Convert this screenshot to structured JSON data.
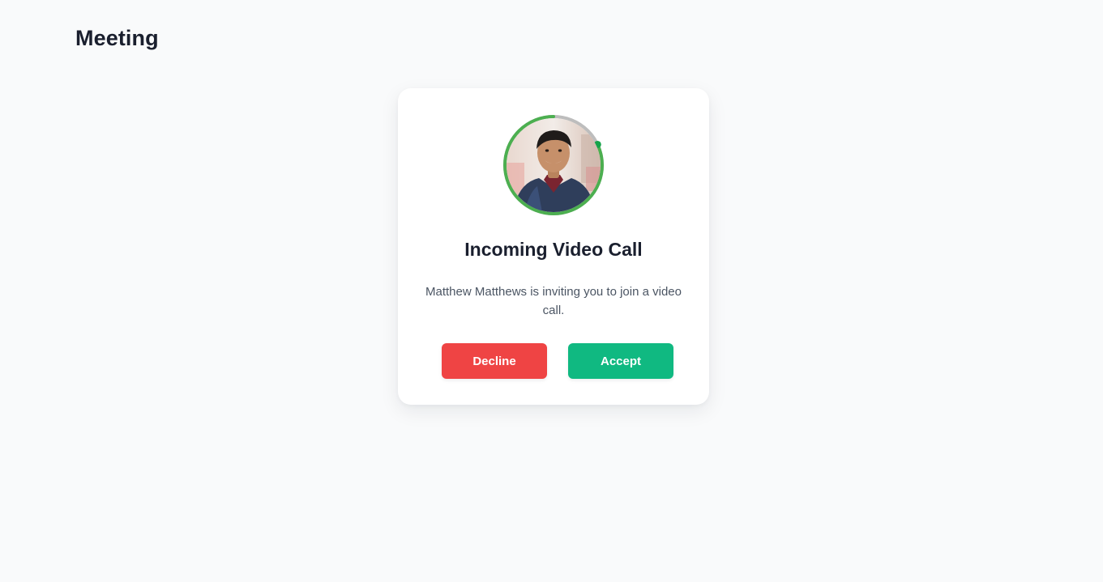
{
  "header": {
    "title": "Meeting"
  },
  "call_card": {
    "title": "Incoming Video Call",
    "message": "Matthew Matthews is inviting you to join a video call.",
    "avatar_icon": "caller-avatar-photo",
    "ring_progress": 0.82,
    "buttons": {
      "decline_label": "Decline",
      "accept_label": "Accept"
    }
  },
  "colors": {
    "page_background": "#f9fafb",
    "ring_active": "#4caf50",
    "ring_track": "#bdbdbd",
    "status_dot": "#16a34a",
    "decline": "#ef4444",
    "accept": "#10b981"
  }
}
